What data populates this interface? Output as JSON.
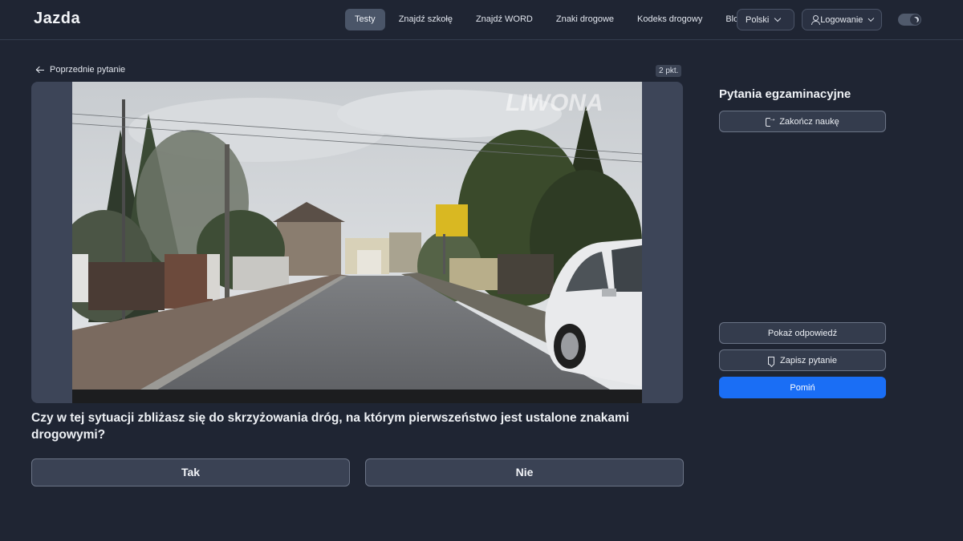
{
  "header": {
    "logo": "Jazda",
    "nav": [
      {
        "label": "Testy",
        "active": true
      },
      {
        "label": "Znajdź szkołę",
        "active": false
      },
      {
        "label": "Znajdź WORD",
        "active": false
      },
      {
        "label": "Znaki drogowe",
        "active": false
      },
      {
        "label": "Kodeks drogowy",
        "active": false
      },
      {
        "label": "Blog",
        "active": false
      }
    ],
    "language": "Polski",
    "login": "Logowanie",
    "theme": "dark"
  },
  "question": {
    "back_label": "Poprzednie pytanie",
    "points": "2 pkt.",
    "image_watermark": "LIWONA",
    "text": "Czy w tej sytuacji zbliżasz się do skrzyżowania dróg, na którym pierwszeństwo jest ustalone znakami drogowymi?",
    "answers": [
      "Tak",
      "Nie"
    ]
  },
  "sidebar": {
    "title": "Pytania egzaminacyjne",
    "end_label": "Zakończ naukę",
    "show_answer_label": "Pokaż odpowiedź",
    "save_label": "Zapisz pytanie",
    "skip_label": "Pomiń"
  },
  "colors": {
    "background": "#1f2533",
    "accent": "#1a6ef5"
  }
}
